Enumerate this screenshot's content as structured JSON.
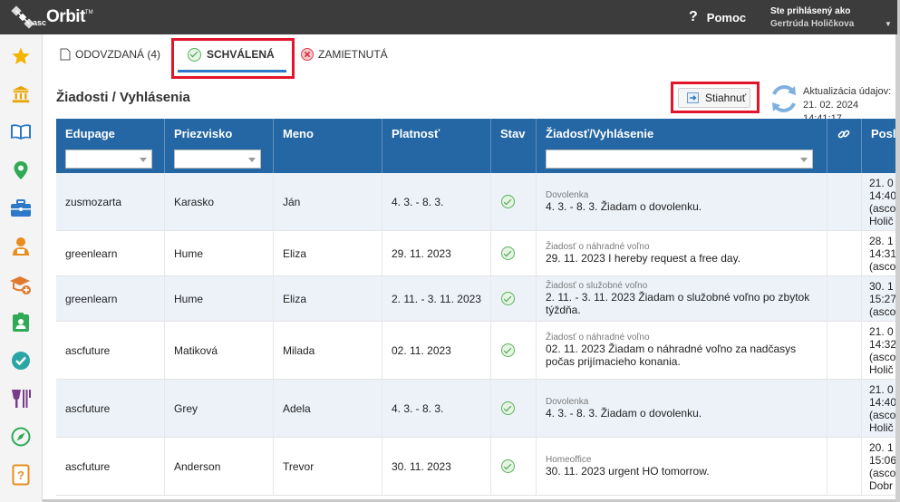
{
  "app": {
    "logo_asc": "asc",
    "logo_orbit": "Orbit",
    "logo_tm": "TM"
  },
  "header": {
    "help_icon": "?",
    "help_label": "Pomoc",
    "logged_in_label": "Ste prihlásený ako",
    "user_name": "Gertrúda Holičkova"
  },
  "sidebar": [
    {
      "icon": "star-icon",
      "color": "#f2b500"
    },
    {
      "icon": "bank-icon",
      "color": "#e8a400"
    },
    {
      "icon": "book-icon",
      "color": "#2d79c7"
    },
    {
      "icon": "map-pin-icon",
      "color": "#2faa55"
    },
    {
      "icon": "briefcase-icon",
      "color": "#2d79c7"
    },
    {
      "icon": "person-icon",
      "color": "#e88d1e"
    },
    {
      "icon": "graduation-icon",
      "color": "#e07a2f"
    },
    {
      "icon": "id-badge-icon",
      "color": "#2faa55"
    },
    {
      "icon": "check-circle-icon",
      "color": "#2aa5a5"
    },
    {
      "icon": "food-icon",
      "color": "#7a3b8c"
    },
    {
      "icon": "compass-icon",
      "color": "#2faa55"
    },
    {
      "icon": "help-book-icon",
      "color": "#e88d1e"
    }
  ],
  "tabs": {
    "pending": "ODOVZDANÁ (4)",
    "approved": "SCHVÁLENÁ",
    "rejected": "ZAMIETNUTÁ"
  },
  "page": {
    "title": "Žiadosti / Vyhlásenia",
    "download_label": "Stiahnuť",
    "update_label": "Aktualizácia údajov:",
    "update_time": "21. 02. 2024 14:41:17"
  },
  "table": {
    "columns": [
      "Edupage",
      "Priezvisko",
      "Meno",
      "Platnosť",
      "Stav",
      "Žiadosť/Vyhlásenie",
      "",
      "Posl"
    ],
    "rows": [
      {
        "edupage": "zusmozarta",
        "surname": "Karasko",
        "name": "Ján",
        "validity": "4. 3. - 8. 3.",
        "type": "Dovolenka",
        "text": "4. 3. - 8. 3. Žiadam o dovolenku.",
        "last": "21. 0\n14:40\n(asco\nHolič"
      },
      {
        "edupage": "greenlearn",
        "surname": "Hume",
        "name": "Eliza",
        "validity": "29. 11. 2023",
        "type": "Žiadosť o náhradné voľno",
        "text": "29. 11. 2023 I hereby request a free day.",
        "last": "28. 1\n14:31\n(asco"
      },
      {
        "edupage": "greenlearn",
        "surname": "Hume",
        "name": "Eliza",
        "validity": "2. 11. - 3. 11. 2023",
        "type": "Žiadosť o služobné voľno",
        "text": "2. 11. - 3. 11. 2023 Žiadam o služobné voľno po zbytok týždňa.",
        "last": "30. 1\n15:27\n(asco"
      },
      {
        "edupage": "ascfuture",
        "surname": "Matiková",
        "name": "Milada",
        "validity": "02. 11. 2023",
        "type": "Žiadosť o náhradné voľno",
        "text": "02. 11. 2023 Žiadam o náhradné voľno za nadčasys počas prijímacieho konania.",
        "last": "21. 0\n14:32\n(asco\nHolič"
      },
      {
        "edupage": "ascfuture",
        "surname": "Grey",
        "name": "Adela",
        "validity": "4. 3. - 8. 3.",
        "type": "Dovolenka",
        "text": "4. 3. - 8. 3. Žiadam o dovolenku.",
        "last": "21. 0\n14:40\n(asco\nHolič"
      },
      {
        "edupage": "ascfuture",
        "surname": "Anderson",
        "name": "Trevor",
        "validity": "30. 11. 2023",
        "type": "Homeoffice",
        "text": "30. 11. 2023 urgent HO tomorrow.",
        "last": "20. 1\n15:06\n(asco\nDobr"
      }
    ]
  }
}
